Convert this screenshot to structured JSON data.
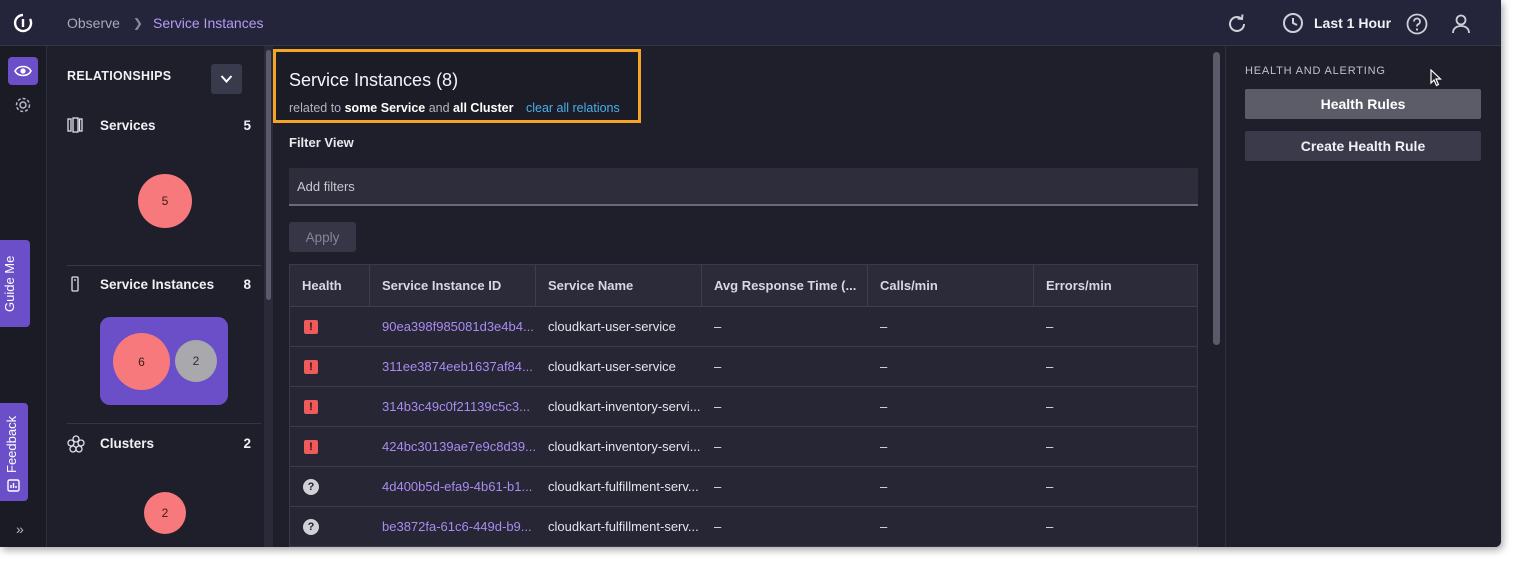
{
  "breadcrumb": {
    "root": "Observe",
    "current": "Service Instances"
  },
  "time_range": {
    "label": "Last 1 Hour"
  },
  "rail": {
    "guide_label": "Guide Me",
    "feedback_label": "Feedback",
    "expand_label": "»"
  },
  "relationships": {
    "title": "RELATIONSHIPS",
    "entities": [
      {
        "label": "Services",
        "count": "5",
        "bubbles": [
          "5"
        ]
      },
      {
        "label": "Service Instances",
        "count": "8",
        "bubbles": [
          "6",
          "2"
        ]
      },
      {
        "label": "Clusters",
        "count": "2",
        "bubbles": [
          "2"
        ]
      }
    ]
  },
  "main": {
    "title": "Service Instances (8)",
    "related_prefix": "related to",
    "related_a": "some Service",
    "related_and": "and",
    "related_b": "all Cluster",
    "clear_link": "clear all relations",
    "filter_label": "Filter View",
    "filter_placeholder": "Add filters",
    "apply_label": "Apply"
  },
  "table": {
    "columns": [
      "Health",
      "Service Instance ID",
      "Service Name",
      "Avg Response Time (...",
      "Calls/min",
      "Errors/min"
    ],
    "rows": [
      {
        "health": "error",
        "id": "90ea398f985081d3e4b4...",
        "name": "cloudkart-user-service",
        "art": "–",
        "calls": "–",
        "errors": "–"
      },
      {
        "health": "error",
        "id": "311ee3874eeb1637af84...",
        "name": "cloudkart-user-service",
        "art": "–",
        "calls": "–",
        "errors": "–"
      },
      {
        "health": "error",
        "id": "314b3c49c0f21139c5c3...",
        "name": "cloudkart-inventory-servi...",
        "art": "–",
        "calls": "–",
        "errors": "–"
      },
      {
        "health": "error",
        "id": "424bc30139ae7e9c8d39...",
        "name": "cloudkart-inventory-servi...",
        "art": "–",
        "calls": "–",
        "errors": "–"
      },
      {
        "health": "unknown",
        "id": "4d400b5d-efa9-4b61-b1...",
        "name": "cloudkart-fulfillment-serv...",
        "art": "–",
        "calls": "–",
        "errors": "–"
      },
      {
        "health": "unknown",
        "id": "be3872fa-61c6-449d-b9...",
        "name": "cloudkart-fulfillment-serv...",
        "art": "–",
        "calls": "–",
        "errors": "–"
      }
    ]
  },
  "health_panel": {
    "title": "HEALTH AND ALERTING",
    "health_rules_label": "Health Rules",
    "create_label": "Create Health Rule"
  },
  "colors": {
    "accent": "#6b4fc9",
    "highlight": "#f5a524",
    "link": "#4aaee8",
    "error": "#ef5a5a",
    "bubble": "#f8797b"
  }
}
